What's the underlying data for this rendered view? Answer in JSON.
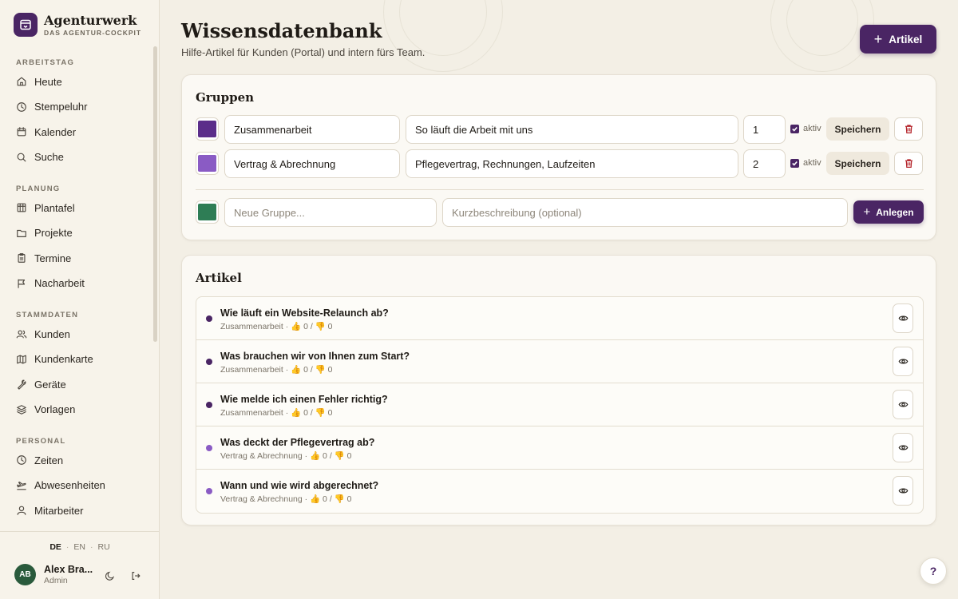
{
  "brand": {
    "name": "Agenturwerk",
    "subtitle": "DAS AGENTUR-COCKPIT"
  },
  "sidebar": {
    "sections": [
      {
        "title": "ARBEITSTAG",
        "items": [
          {
            "label": "Heute",
            "icon": "home-icon"
          },
          {
            "label": "Stempeluhr",
            "icon": "clock-icon"
          },
          {
            "label": "Kalender",
            "icon": "calendar-icon"
          },
          {
            "label": "Suche",
            "icon": "search-icon"
          }
        ]
      },
      {
        "title": "PLANUNG",
        "items": [
          {
            "label": "Plantafel",
            "icon": "board-icon"
          },
          {
            "label": "Projekte",
            "icon": "folder-icon"
          },
          {
            "label": "Termine",
            "icon": "clipboard-icon"
          },
          {
            "label": "Nacharbeit",
            "icon": "flag-icon"
          }
        ]
      },
      {
        "title": "STAMMDATEN",
        "items": [
          {
            "label": "Kunden",
            "icon": "users-icon"
          },
          {
            "label": "Kundenkarte",
            "icon": "map-icon"
          },
          {
            "label": "Geräte",
            "icon": "wrench-icon"
          },
          {
            "label": "Vorlagen",
            "icon": "layers-icon"
          }
        ]
      },
      {
        "title": "PERSONAL",
        "items": [
          {
            "label": "Zeiten",
            "icon": "clock-icon"
          },
          {
            "label": "Abwesenheiten",
            "icon": "plane-icon"
          },
          {
            "label": "Mitarbeiter",
            "icon": "user-icon"
          }
        ]
      }
    ],
    "languages": [
      "DE",
      "EN",
      "RU"
    ],
    "active_language": "DE",
    "user": {
      "initials": "AB",
      "name": "Alex Bra...",
      "role": "Admin"
    }
  },
  "header": {
    "title": "Wissensdatenbank",
    "subtitle": "Hilfe-Artikel für Kunden (Portal) und intern fürs Team.",
    "add_button": "Artikel"
  },
  "groups": {
    "title": "Gruppen",
    "rows": [
      {
        "color": "#5b2d8a",
        "name": "Zusammenarbeit",
        "description": "So läuft die Arbeit mit uns",
        "order": "1",
        "active_label": "aktiv",
        "save_label": "Speichern"
      },
      {
        "color": "#8a5bc4",
        "name": "Vertrag & Abrechnung",
        "description": "Pflegevertrag, Rechnungen, Laufzeiten",
        "order": "2",
        "active_label": "aktiv",
        "save_label": "Speichern"
      }
    ],
    "new": {
      "color": "#2e7d55",
      "name_placeholder": "Neue Gruppe...",
      "description_placeholder": "Kurzbeschreibung (optional)",
      "create_label": "Anlegen"
    }
  },
  "articles": {
    "title": "Artikel",
    "items": [
      {
        "title": "Wie läuft ein Website-Relaunch ab?",
        "meta": "Zusammenarbeit · 👍 0 / 👎 0",
        "color": "#4a2564"
      },
      {
        "title": "Was brauchen wir von Ihnen zum Start?",
        "meta": "Zusammenarbeit · 👍 0 / 👎 0",
        "color": "#4a2564"
      },
      {
        "title": "Wie melde ich einen Fehler richtig?",
        "meta": "Zusammenarbeit · 👍 0 / 👎 0",
        "color": "#4a2564"
      },
      {
        "title": "Was deckt der Pflegevertrag ab?",
        "meta": "Vertrag & Abrechnung · 👍 0 / 👎 0",
        "color": "#8a5bc4"
      },
      {
        "title": "Wann und wie wird abgerechnet?",
        "meta": "Vertrag & Abrechnung · 👍 0 / 👎 0",
        "color": "#8a5bc4"
      }
    ]
  },
  "help_label": "?"
}
